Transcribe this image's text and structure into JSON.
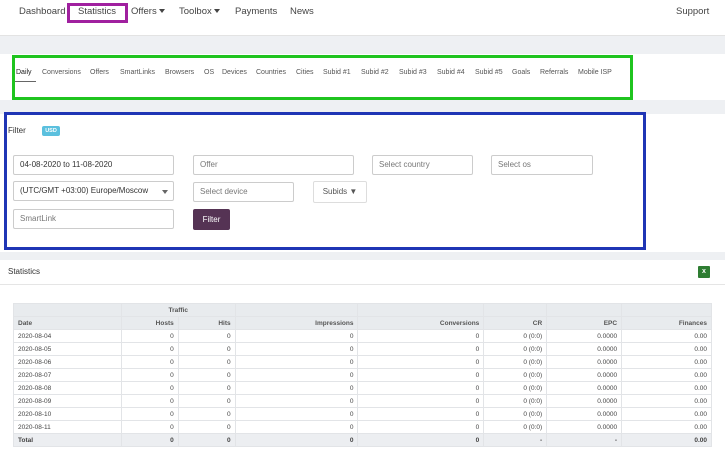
{
  "topnav": {
    "dashboard": "Dashboard",
    "statistics": "Statistics",
    "offers": "Offers",
    "toolbox": "Toolbox",
    "payments": "Payments",
    "news": "News",
    "support": "Support"
  },
  "tabs": [
    "Daily",
    "Conversions",
    "Offers",
    "SmartLinks",
    "Browsers",
    "OS",
    "Devices",
    "Countries",
    "Cities",
    "Subid #1",
    "Subid #2",
    "Subid #3",
    "Subid #4",
    "Subid #5",
    "Goals",
    "Referrals",
    "Mobile ISP"
  ],
  "filter": {
    "title": "Filter",
    "currency": "USD",
    "date_range": "04-08-2020 to 11-08-2020",
    "offer_placeholder": "Offer",
    "country_placeholder": "Select country",
    "os_placeholder": "Select os",
    "timezone": "(UTC/GMT +03:00) Europe/Moscow",
    "device_placeholder": "Select device",
    "subids_label": "Subids ▼",
    "smartlink_placeholder": "SmartLink",
    "filter_button": "Filter"
  },
  "statistics": {
    "title": "Statistics",
    "group_header": "Traffic",
    "columns": [
      "Date",
      "Hosts",
      "Hits",
      "Impressions",
      "Conversions",
      "CR",
      "EPC",
      "Finances"
    ],
    "rows": [
      [
        "2020-08-04",
        "0",
        "0",
        "0",
        "0",
        "0 (0:0)",
        "0.0000",
        "0.00"
      ],
      [
        "2020-08-05",
        "0",
        "0",
        "0",
        "0",
        "0 (0:0)",
        "0.0000",
        "0.00"
      ],
      [
        "2020-08-06",
        "0",
        "0",
        "0",
        "0",
        "0 (0:0)",
        "0.0000",
        "0.00"
      ],
      [
        "2020-08-07",
        "0",
        "0",
        "0",
        "0",
        "0 (0:0)",
        "0.0000",
        "0.00"
      ],
      [
        "2020-08-08",
        "0",
        "0",
        "0",
        "0",
        "0 (0:0)",
        "0.0000",
        "0.00"
      ],
      [
        "2020-08-09",
        "0",
        "0",
        "0",
        "0",
        "0 (0:0)",
        "0.0000",
        "0.00"
      ],
      [
        "2020-08-10",
        "0",
        "0",
        "0",
        "0",
        "0 (0:0)",
        "0.0000",
        "0.00"
      ],
      [
        "2020-08-11",
        "0",
        "0",
        "0",
        "0",
        "0 (0:0)",
        "0.0000",
        "0.00"
      ]
    ],
    "total": [
      "Total",
      "0",
      "0",
      "0",
      "0",
      "-",
      "-",
      "0.00"
    ]
  },
  "colors": {
    "highlight_purple": "#a0209f",
    "highlight_green": "#1fc41f",
    "highlight_blue": "#1f35b5",
    "filter_button": "#553354",
    "badge": "#5bc0de"
  }
}
